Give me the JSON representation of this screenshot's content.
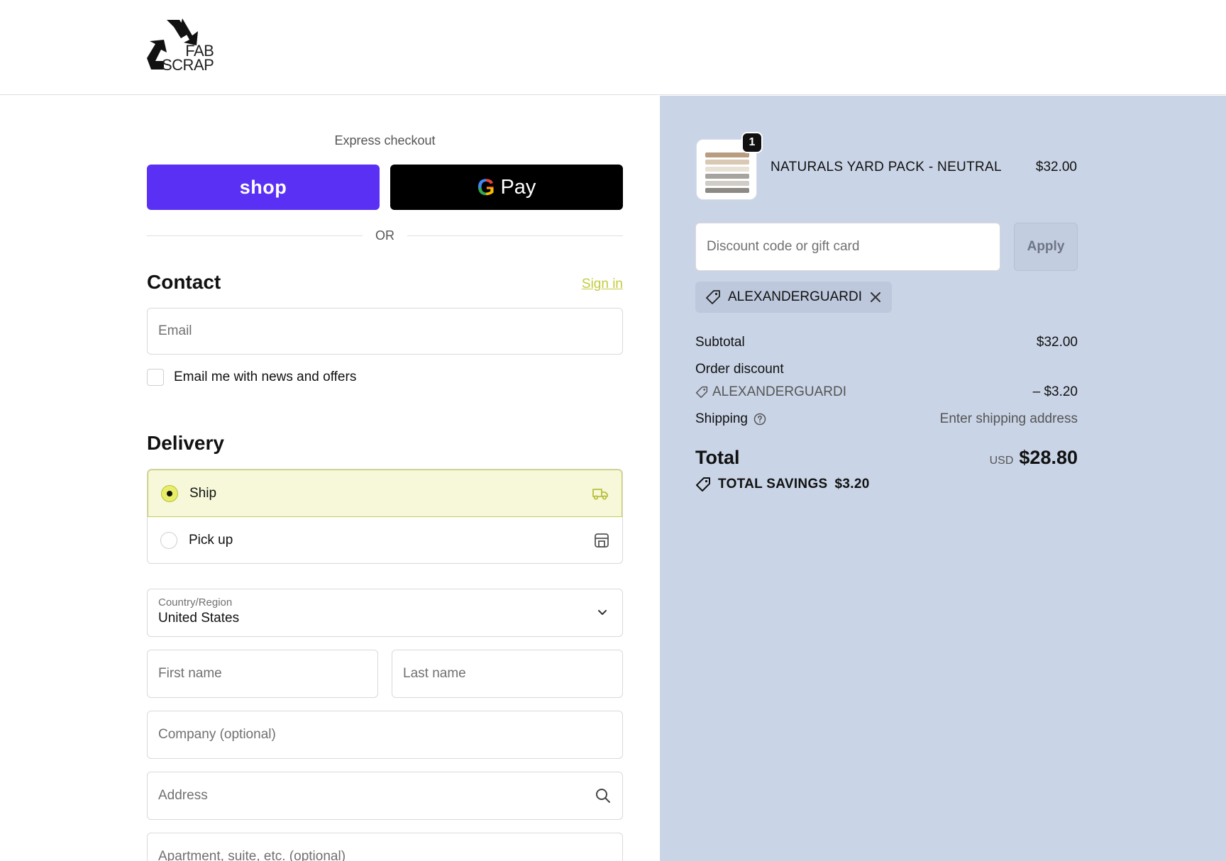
{
  "brand": {
    "logo_line1": "FAB",
    "logo_line2": "SCRAP"
  },
  "express": {
    "label": "Express checkout",
    "shop_label": "shop",
    "gpay_g": "G",
    "gpay_label": "Pay",
    "or_label": "OR"
  },
  "contact": {
    "title": "Contact",
    "signin_label": "Sign in",
    "email_placeholder": "Email",
    "news_label": "Email me with news and offers"
  },
  "delivery": {
    "title": "Delivery",
    "options": [
      {
        "label": "Ship",
        "selected": true,
        "icon": "truck-icon"
      },
      {
        "label": "Pick up",
        "selected": false,
        "icon": "store-icon"
      }
    ],
    "country_label": "Country/Region",
    "country_value": "United States",
    "first_name_placeholder": "First name",
    "last_name_placeholder": "Last name",
    "company_placeholder": "Company (optional)",
    "address_placeholder": "Address",
    "apartment_placeholder": "Apartment, suite, etc. (optional)"
  },
  "summary": {
    "item": {
      "name": "NATURALS YARD PACK - NEUTRAL",
      "price": "$32.00",
      "quantity": "1"
    },
    "discount_placeholder": "Discount code or gift card",
    "apply_label": "Apply",
    "applied_code": "ALEXANDERGUARDI",
    "subtotal_label": "Subtotal",
    "subtotal_value": "$32.00",
    "order_discount_label": "Order discount",
    "order_discount_code": "ALEXANDERGUARDI",
    "order_discount_value": "– $3.20",
    "shipping_label": "Shipping",
    "shipping_value": "Enter shipping address",
    "total_label": "Total",
    "total_currency": "USD",
    "total_value": "$28.80",
    "savings_label": "TOTAL SAVINGS",
    "savings_value": "$3.20"
  },
  "colors": {
    "shop_purple": "#5a31f4",
    "accent_lime": "#c4cc3f",
    "summary_bg": "#c9d4e6"
  }
}
